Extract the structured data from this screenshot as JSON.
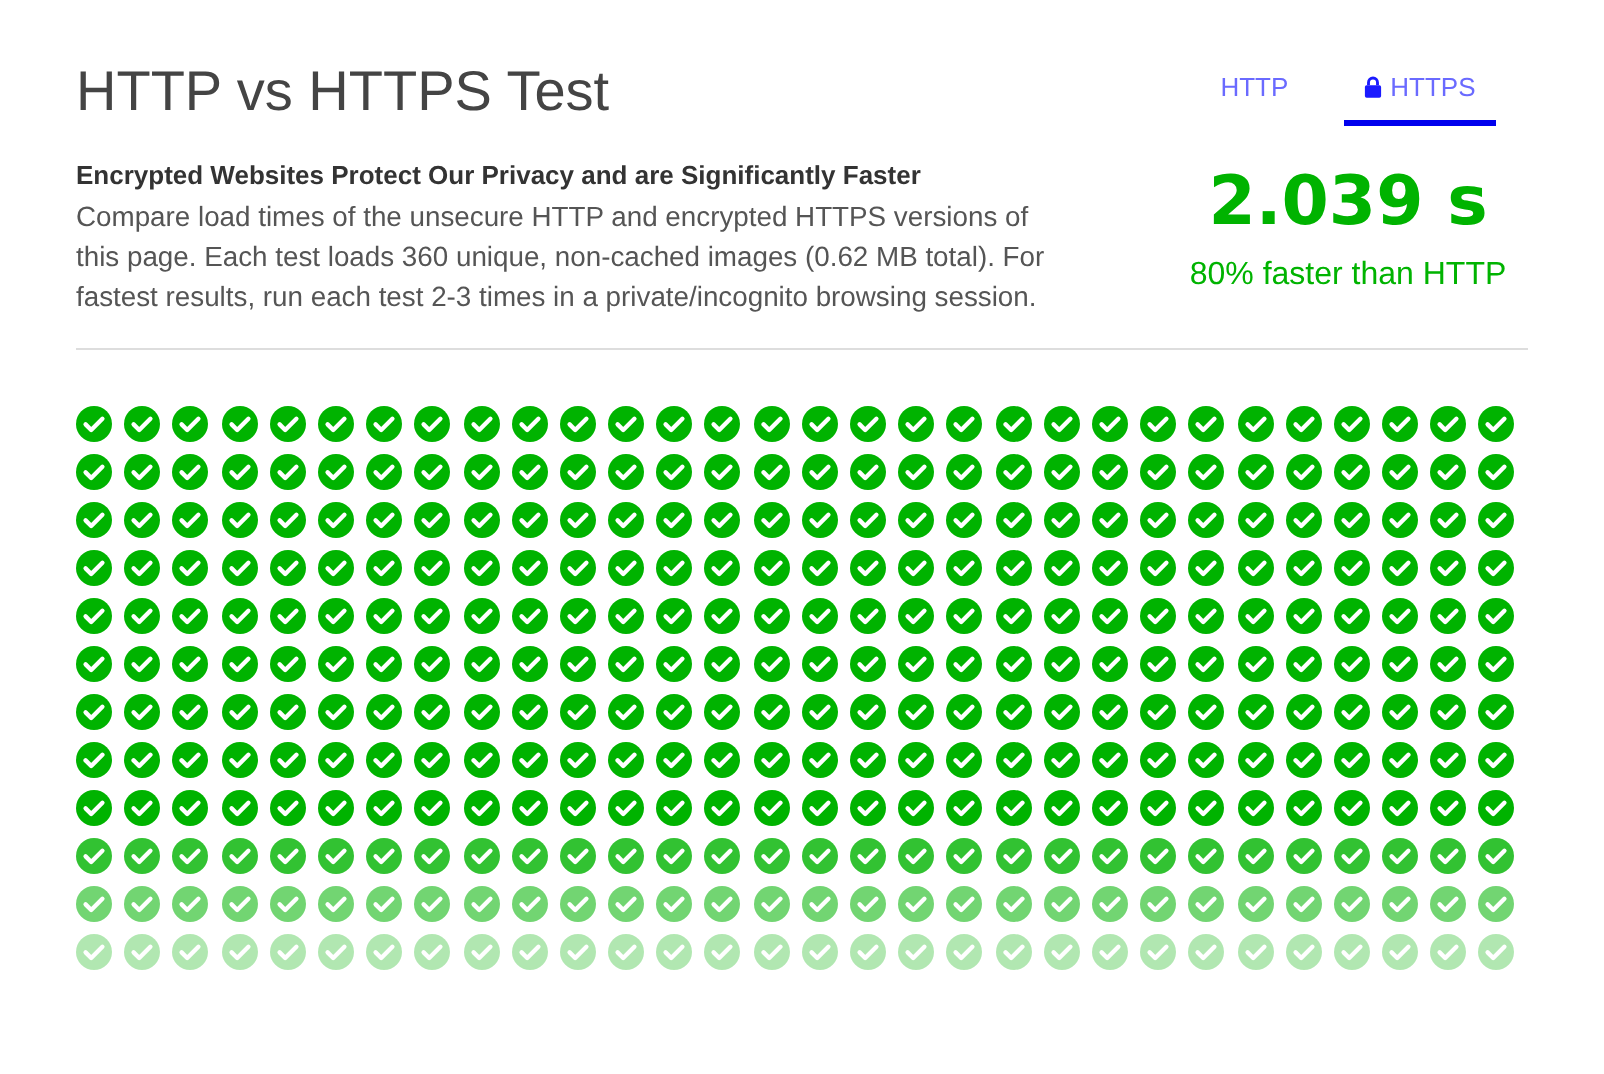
{
  "title": "HTTP vs HTTPS Test",
  "intro": {
    "heading": "Encrypted Websites Protect Our Privacy and are Significantly Faster",
    "body": "Compare load times of the unsecure HTTP and encrypted HTTPS versions of this page. Each test loads 360 unique, non-cached images (0.62 MB total). For fastest results, run each test 2-3 times in a private/incognito browsing session."
  },
  "tabs": [
    {
      "label": "HTTP",
      "selected": false,
      "secure": false
    },
    {
      "label": "HTTPS",
      "selected": true,
      "secure": true
    }
  ],
  "result": {
    "time": "2.039 s",
    "comparison": "80% faster than HTTP"
  }
}
